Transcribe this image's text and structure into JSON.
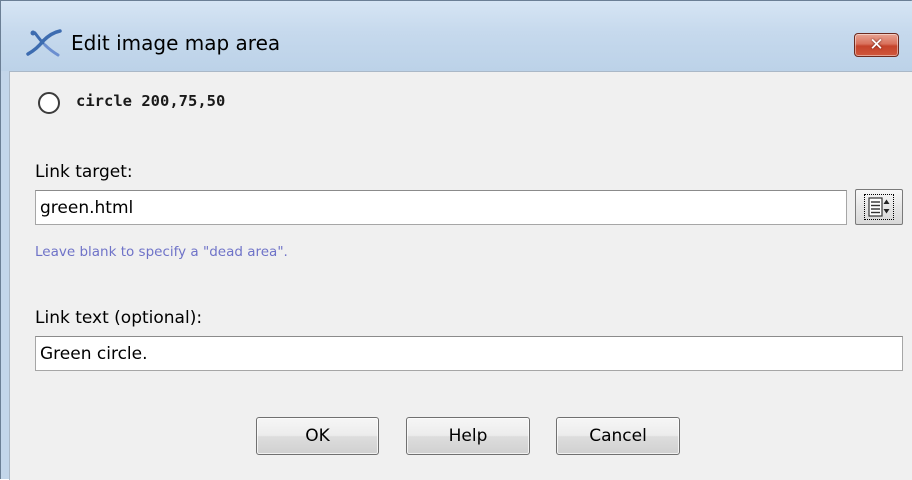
{
  "window": {
    "title": "Edit image map area",
    "close_glyph": "✕"
  },
  "area": {
    "shape_label": "circle 200,75,50",
    "selected": false
  },
  "link_target": {
    "label": "Link target:",
    "value": "green.html",
    "hint": "Leave blank to specify a \"dead area\".",
    "browse_icon": "list-chooser-icon"
  },
  "link_text": {
    "label": "Link text (optional):",
    "value": "Green circle."
  },
  "buttons": {
    "ok": "OK",
    "help": "Help",
    "cancel": "Cancel"
  },
  "colors": {
    "titlebar": "#c6d9ed",
    "client_bg": "#f0f0f0",
    "hint_text": "#6f73c8",
    "close_button": "#d0573c"
  }
}
